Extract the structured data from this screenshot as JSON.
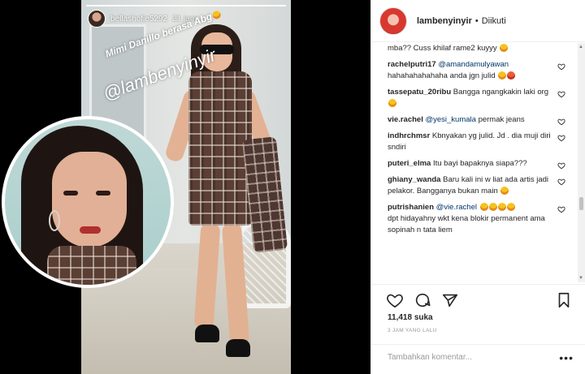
{
  "story": {
    "username": "bellashofie5292",
    "time": "21 jam",
    "caption_line1": "Mimi Danillo berasa Abg",
    "caption_line2": "@lambenyinyir"
  },
  "header": {
    "username": "lambenyinyir",
    "separator": "•",
    "follow_status": "Diikuti"
  },
  "comments": [
    {
      "user": "",
      "text": "mba?? Cuss khilaf rame2 kuyyy",
      "emoji_count": 1
    },
    {
      "user": "rachelputri17",
      "mention": "@amandamulyawan",
      "text": "hahahahahahaha anda jgn julid",
      "emoji_count": 2
    },
    {
      "user": "tassepatu_20ribu",
      "text": "Bangga ngangkakin laki org",
      "emoji_count": 1
    },
    {
      "user": "vie.rachel",
      "mention": "@yesi_kumala",
      "text": "permak jeans",
      "emoji_count": 0
    },
    {
      "user": "indhrchmsr",
      "text": "Kbnyakan yg julid. Jd . dia muji diri sndiri",
      "emoji_count": 0
    },
    {
      "user": "puteri_elma",
      "text": "Itu bayi bapaknya siapa???",
      "emoji_count": 0
    },
    {
      "user": "ghiany_wanda",
      "text": "Baru kali ini w liat ada artis jadi pelakor. Bangganya bukan main",
      "emoji_count": 1
    },
    {
      "user": "putrishanien",
      "mention": "@vie.rachel",
      "text": "dpt hidayahny wkt kena blokir permanent ama sopinah n tata liem",
      "emoji_count": 4
    }
  ],
  "likes": "11,418 suka",
  "time_ago": "3 JAM YANG LALU",
  "comment_box": {
    "placeholder": "Tambahkan komentar...",
    "more_label": "•••"
  },
  "icons": {
    "like": "heart-icon",
    "comment": "comment-icon",
    "share": "share-icon",
    "save": "bookmark-icon"
  }
}
